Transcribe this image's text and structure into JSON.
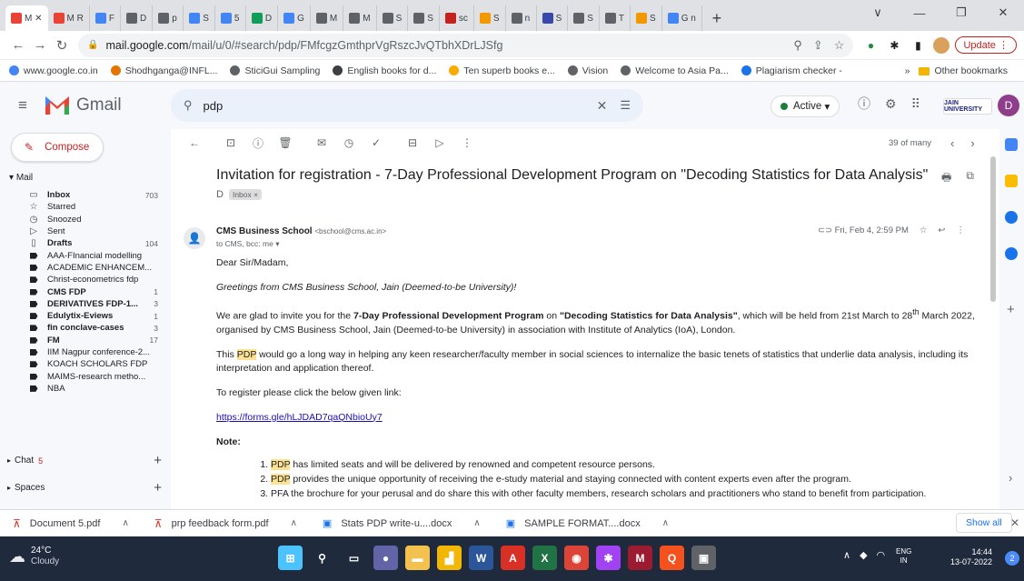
{
  "browser": {
    "tabs": [
      {
        "label": "M ✕",
        "color": "#ea4335",
        "active": true
      },
      {
        "label": "M R",
        "color": "#ea4335"
      },
      {
        "label": "F",
        "color": "#4285f4"
      },
      {
        "label": "D",
        "color": "#5f6368"
      },
      {
        "label": "p",
        "color": "#5f6368"
      },
      {
        "label": "S",
        "color": "#4285f4"
      },
      {
        "label": "5",
        "color": "#4285f4"
      },
      {
        "label": "D",
        "color": "#0f9d58"
      },
      {
        "label": "G",
        "color": "#4285f4"
      },
      {
        "label": "M",
        "color": "#5f6368"
      },
      {
        "label": "M",
        "color": "#5f6368"
      },
      {
        "label": "S",
        "color": "#5f6368"
      },
      {
        "label": "S",
        "color": "#5f6368"
      },
      {
        "label": "sc",
        "color": "#c5221f"
      },
      {
        "label": "S",
        "color": "#f29900"
      },
      {
        "label": "n",
        "color": "#5f6368"
      },
      {
        "label": "S",
        "color": "#3949ab"
      },
      {
        "label": "S",
        "color": "#5f6368"
      },
      {
        "label": "T",
        "color": "#5f6368"
      },
      {
        "label": "S",
        "color": "#f29900"
      },
      {
        "label": "G n",
        "color": "#4285f4"
      }
    ],
    "new_tab_symbol": "+",
    "window_controls": [
      "∨",
      "—",
      "❐",
      "✕"
    ],
    "url_host": "mail.google.com",
    "url_path": "/mail/u/0/#search/pdp/FMfcgzGmthprVgRszcJvQTbhXDrLJSfg",
    "update_label": "Update",
    "bookmarks": [
      {
        "label": "www.google.co.in",
        "color": "#4285f4"
      },
      {
        "label": "Shodhganga@INFL...",
        "color": "#e37400"
      },
      {
        "label": "SticiGui Sampling",
        "color": "#5f6368"
      },
      {
        "label": "English books for d...",
        "color": "#3c4043"
      },
      {
        "label": "Ten superb books e...",
        "color": "#f9ab00"
      },
      {
        "label": "Vision",
        "color": "#5f6368"
      },
      {
        "label": "Welcome to Asia Pa...",
        "color": "#5f6368"
      },
      {
        "label": "Plagiarism checker -",
        "color": "#1a73e8"
      }
    ],
    "bookmarks_more": "»",
    "other_bookmarks": "Other bookmarks"
  },
  "gmail": {
    "app_name": "Gmail",
    "search_value": "pdp",
    "status": "Active",
    "status_color": "#188038",
    "org_label": "JAIN UNIVERSITY",
    "avatar_letter": "D",
    "compose_label": "Compose",
    "mail_section": "Mail",
    "nav_items": [
      {
        "label": "Inbox",
        "count": "703",
        "bold": true,
        "icon": "inbox-icon",
        "glyph": "▭"
      },
      {
        "label": "Starred",
        "count": "",
        "bold": false,
        "icon": "star-icon",
        "glyph": "☆"
      },
      {
        "label": "Snoozed",
        "count": "",
        "bold": false,
        "icon": "clock-icon",
        "glyph": "◷"
      },
      {
        "label": "Sent",
        "count": "",
        "bold": false,
        "icon": "send-icon",
        "glyph": "▷"
      },
      {
        "label": "Drafts",
        "count": "104",
        "bold": true,
        "icon": "draft-icon",
        "glyph": "▯"
      },
      {
        "label": "AAA-FInancial modelling",
        "count": "",
        "bold": false,
        "icon": "label-icon"
      },
      {
        "label": "ACADEMIC ENHANCEM...",
        "count": "",
        "bold": false,
        "icon": "label-icon"
      },
      {
        "label": "Christ-econometrics fdp",
        "count": "",
        "bold": false,
        "icon": "label-icon"
      },
      {
        "label": "CMS FDP",
        "count": "1",
        "bold": true,
        "icon": "label-icon"
      },
      {
        "label": "DERIVATIVES FDP-1...",
        "count": "3",
        "bold": true,
        "icon": "label-icon"
      },
      {
        "label": "Edulytix-Eviews",
        "count": "1",
        "bold": true,
        "icon": "label-icon"
      },
      {
        "label": "fin conclave-cases",
        "count": "3",
        "bold": true,
        "icon": "label-icon"
      },
      {
        "label": "FM",
        "count": "17",
        "bold": true,
        "icon": "label-icon"
      },
      {
        "label": "IIM Nagpur conference-2...",
        "count": "",
        "bold": false,
        "icon": "label-icon"
      },
      {
        "label": "KOACH SCHOLARS FDP",
        "count": "",
        "bold": false,
        "icon": "label-icon"
      },
      {
        "label": "MAIMS-research metho...",
        "count": "",
        "bold": false,
        "icon": "label-icon"
      },
      {
        "label": "NBA",
        "count": "",
        "bold": false,
        "icon": "label-icon"
      }
    ],
    "chat_label": "Chat",
    "chat_badge": "5",
    "spaces_label": "Spaces",
    "pager": "39 of many"
  },
  "email": {
    "subject": "Invitation for registration - 7-Day Professional Development Program on \"Decoding Statistics for Data Analysis\"",
    "label": "Inbox",
    "sender_name": "CMS Business School",
    "sender_email": "<bschool@cms.ac.in>",
    "to_line": "to CMS, bcc: me",
    "date": "Fri, Feb 4, 2:59 PM",
    "greeting": "Dear Sir/Madam,",
    "greetings_line": "Greetings from CMS Business School, Jain (Deemed-to-be University)!",
    "p1_a": "We are glad to invite you for the ",
    "p1_b": "7-Day Professional Development Program",
    "p1_c": " on ",
    "p1_d": "\"Decoding Statistics for Data Analysis\"",
    "p1_e": ", which will be held from 21st March to 28",
    "p1_sup": "th",
    "p1_f": " March 2022, organised by CMS Business School, Jain (Deemed-to-be University) in association with Institute of Analytics (IoA), London.",
    "p2_a": "This ",
    "p2_hl": "PDP",
    "p2_b": " would go a long way in helping any keen researcher/faculty member in social sciences to internalize the basic tenets of statistics that underlie data analysis, including its interpretation and application thereof.",
    "register_line": "To register please click the below given link:",
    "link": "https://forms.gle/hLJDAD7qaQNbioUy7",
    "note_label": "Note:",
    "notes": [
      {
        "hl": "PDP",
        "text": " has limited seats and will be delivered by renowned and competent resource persons."
      },
      {
        "hl": "PDP",
        "text": " provides the unique opportunity of receiving the e-study material and staying connected with content experts even after the program."
      },
      {
        "hl": "",
        "text": "PFA the brochure for your perusal and do share this with other faculty members, research scholars and practitioners who stand to benefit from participation."
      }
    ]
  },
  "downloads": [
    {
      "name": "Document 5.pdf",
      "type": "pdf"
    },
    {
      "name": "prp feedback form.pdf",
      "type": "pdf"
    },
    {
      "name": "Stats PDP write-u....docx",
      "type": "doc"
    },
    {
      "name": "SAMPLE FORMAT....docx",
      "type": "doc"
    }
  ],
  "show_all_label": "Show all",
  "taskbar": {
    "temperature": "24°C",
    "condition": "Cloudy",
    "apps": [
      {
        "name": "start-button",
        "color": "#4cc2ff",
        "glyph": "⊞"
      },
      {
        "name": "search-button",
        "color": "#1f2a3c",
        "glyph": "⚲"
      },
      {
        "name": "task-view-button",
        "color": "#1f2a3c",
        "glyph": "▭"
      },
      {
        "name": "meet-app",
        "color": "#6264a7",
        "glyph": "●"
      },
      {
        "name": "file-explorer-app",
        "color": "#f2c14e",
        "glyph": "▬"
      },
      {
        "name": "sticky-app",
        "color": "#f2b705",
        "glyph": "▟"
      },
      {
        "name": "word-app",
        "color": "#2b579a",
        "glyph": "W"
      },
      {
        "name": "acrobat-app",
        "color": "#d93025",
        "glyph": "A"
      },
      {
        "name": "excel-app",
        "color": "#217346",
        "glyph": "X"
      },
      {
        "name": "chrome-app",
        "color": "#db4437",
        "glyph": "◉"
      },
      {
        "name": "colorful-app",
        "color": "#a142f4",
        "glyph": "✱"
      },
      {
        "name": "mendeley-app",
        "color": "#9c1b31",
        "glyph": "M"
      },
      {
        "name": "q-app",
        "color": "#f4511e",
        "glyph": "Q"
      },
      {
        "name": "misc-app",
        "color": "#5f6368",
        "glyph": "▣"
      }
    ],
    "lang_top": "ENG",
    "lang_bottom": "IN",
    "time": "14:44",
    "date": "13-07-2022",
    "notif_count": "2"
  }
}
